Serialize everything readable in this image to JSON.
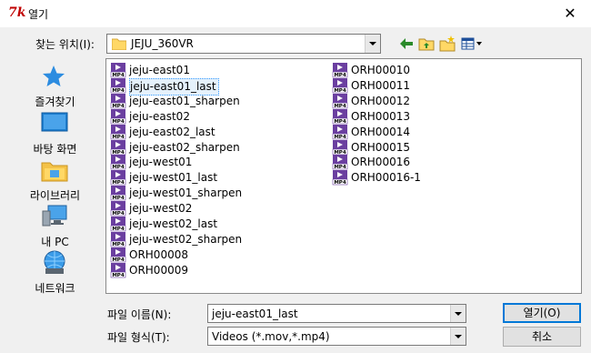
{
  "window": {
    "title": "열기",
    "app_icon_text": "7k",
    "close_glyph": "✕"
  },
  "lookin": {
    "label": "찾는 위치(I):",
    "value": "JEJU_360VR"
  },
  "places": [
    {
      "label": "즐겨찾기",
      "icon": "star-icon"
    },
    {
      "label": "바탕 화면",
      "icon": "desktop-icon"
    },
    {
      "label": "라이브러리",
      "icon": "library-icon"
    },
    {
      "label": "내 PC",
      "icon": "computer-icon"
    },
    {
      "label": "네트워크",
      "icon": "network-icon"
    }
  ],
  "files": [
    {
      "name": "jeju-east01",
      "selected": false
    },
    {
      "name": "jeju-east01_last",
      "selected": true
    },
    {
      "name": "jeju-east01_sharpen",
      "selected": false
    },
    {
      "name": "jeju-east02",
      "selected": false
    },
    {
      "name": "jeju-east02_last",
      "selected": false
    },
    {
      "name": "jeju-east02_sharpen",
      "selected": false
    },
    {
      "name": "jeju-west01",
      "selected": false
    },
    {
      "name": "jeju-west01_last",
      "selected": false
    },
    {
      "name": "jeju-west01_sharpen",
      "selected": false
    },
    {
      "name": "jeju-west02",
      "selected": false
    },
    {
      "name": "jeju-west02_last",
      "selected": false
    },
    {
      "name": "jeju-west02_sharpen",
      "selected": false
    },
    {
      "name": "ORH00008",
      "selected": false
    },
    {
      "name": "ORH00009",
      "selected": false
    },
    {
      "name": "ORH00010",
      "selected": false
    },
    {
      "name": "ORH00011",
      "selected": false
    },
    {
      "name": "ORH00012",
      "selected": false
    },
    {
      "name": "ORH00013",
      "selected": false
    },
    {
      "name": "ORH00014",
      "selected": false
    },
    {
      "name": "ORH00015",
      "selected": false
    },
    {
      "name": "ORH00016",
      "selected": false
    },
    {
      "name": "ORH00016-1",
      "selected": false
    }
  ],
  "file_icon_text": "MP4",
  "filename": {
    "label": "파일 이름(N):",
    "value": "jeju-east01_last"
  },
  "filetype": {
    "label": "파일 형식(T):",
    "value": "Videos (*.mov,*.mp4)"
  },
  "buttons": {
    "open": "열기(O)",
    "cancel": "취소"
  },
  "colors": {
    "selection": "#e5f1fb",
    "focus_border": "#0078d7",
    "mp4_icon": "#6b3fa0"
  }
}
